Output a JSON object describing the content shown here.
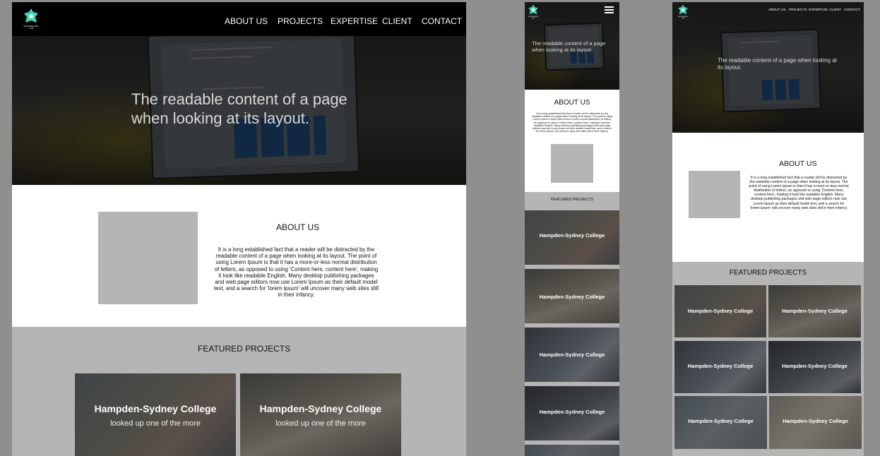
{
  "brand": {
    "logo_text": "WHITEBOARD LAB",
    "accent_color": "#3fd6b5"
  },
  "nav": {
    "about": "ABOUT US",
    "projects": "PROJECTS",
    "expertise": "EXPERTISE",
    "client": "CLIENT",
    "contact": "CONTACT"
  },
  "hero": {
    "line1": "The readable content of a page",
    "line2": "when looking at its layout.",
    "mobile_text": "The readable content of a page when looking at its layout."
  },
  "about": {
    "title": "ABOUT US",
    "body": "It is a long established fact that a reader will be distracted by the readable content of a page when looking at its layout. The point of using Lorem Ipsum is that it has a more-or-less normal distribution of letters, as opposed to using 'Content here, content here', making it look like readable English. Many desktop publishing packages and web page editors now use Lorem Ipsum as their default model text, and a search for 'lorem ipsum' will uncover many web sites still in their infancy."
  },
  "featured": {
    "title": "FEATURED PROJECTS",
    "cards": [
      {
        "title": "Hampden-Sydney College",
        "subtitle": "looked up one of the more"
      },
      {
        "title": "Hampden-Sydney College",
        "subtitle": "looked up one of the more"
      },
      {
        "title": "Hampden-Sydney College"
      },
      {
        "title": "Hampden-Sydney College"
      },
      {
        "title": "Hampden-Sydney College"
      },
      {
        "title": "Hampden-Sydney College"
      }
    ]
  },
  "icons": {
    "menu": "hamburger-menu-icon",
    "logo": "whiteboard-logo-icon"
  }
}
